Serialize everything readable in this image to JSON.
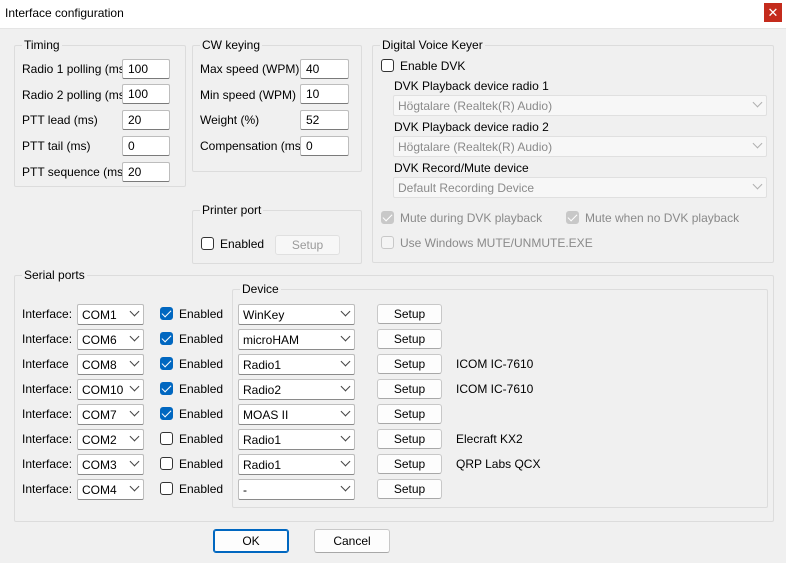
{
  "window": {
    "title": "Interface configuration",
    "close_glyph": "✕"
  },
  "timing": {
    "label": "Timing",
    "rows": [
      {
        "label": "Radio 1 polling (ms)",
        "value": "100"
      },
      {
        "label": "Radio 2 polling (ms)",
        "value": "100"
      },
      {
        "label": "PTT lead (ms)",
        "value": "20"
      },
      {
        "label": "PTT tail (ms)",
        "value": "0"
      },
      {
        "label": "PTT sequence (ms)",
        "value": "20"
      }
    ]
  },
  "cw": {
    "label": "CW keying",
    "rows": [
      {
        "label": "Max speed (WPM)",
        "value": "40"
      },
      {
        "label": "Min speed (WPM)",
        "value": "10"
      },
      {
        "label": "Weight (%)",
        "value": "52"
      },
      {
        "label": "Compensation (ms)",
        "value": "0"
      }
    ]
  },
  "printer": {
    "label": "Printer port",
    "enabled_label": "Enabled",
    "enabled": false,
    "setup_label": "Setup"
  },
  "dvk": {
    "label": "Digital Voice Keyer",
    "enable_label": "Enable DVK",
    "enabled": false,
    "playback1_label": "DVK Playback device radio 1",
    "playback1_value": "Högtalare (Realtek(R) Audio)",
    "playback2_label": "DVK Playback device radio 2",
    "playback2_value": "Högtalare (Realtek(R) Audio)",
    "record_label": "DVK Record/Mute device",
    "record_value": "Default Recording Device",
    "mute_during_label": "Mute during DVK playback",
    "mute_during": true,
    "mute_when_no_label": "Mute when no DVK playback",
    "mute_when_no": true,
    "use_windows_mute_label": "Use Windows MUTE/UNMUTE.EXE",
    "use_windows_mute": false
  },
  "serial": {
    "label": "Serial ports",
    "device_label": "Device",
    "enabled_label": "Enabled",
    "setup_label": "Setup",
    "rows": [
      {
        "iface_label": "Interface:",
        "port": "COM1",
        "enabled": true,
        "device": "WinKey",
        "note": ""
      },
      {
        "iface_label": "Interface:",
        "port": "COM6",
        "enabled": true,
        "device": "microHAM",
        "note": ""
      },
      {
        "iface_label": "Interface",
        "port": "COM8",
        "enabled": true,
        "device": "Radio1",
        "note": "ICOM IC-7610"
      },
      {
        "iface_label": "Interface:",
        "port": "COM10",
        "enabled": true,
        "device": "Radio2",
        "note": "ICOM IC-7610"
      },
      {
        "iface_label": "Interface:",
        "port": "COM7",
        "enabled": true,
        "device": "MOAS II",
        "note": ""
      },
      {
        "iface_label": "Interface:",
        "port": "COM2",
        "enabled": false,
        "device": "Radio1",
        "note": "Elecraft KX2"
      },
      {
        "iface_label": "Interface:",
        "port": "COM3",
        "enabled": false,
        "device": "Radio1",
        "note": "QRP Labs QCX"
      },
      {
        "iface_label": "Interface:",
        "port": "COM4",
        "enabled": false,
        "device": "-",
        "note": ""
      }
    ]
  },
  "footer": {
    "ok_label": "OK",
    "cancel_label": "Cancel"
  },
  "colors": {
    "accent": "#0067c0",
    "close": "#c42b1c"
  }
}
